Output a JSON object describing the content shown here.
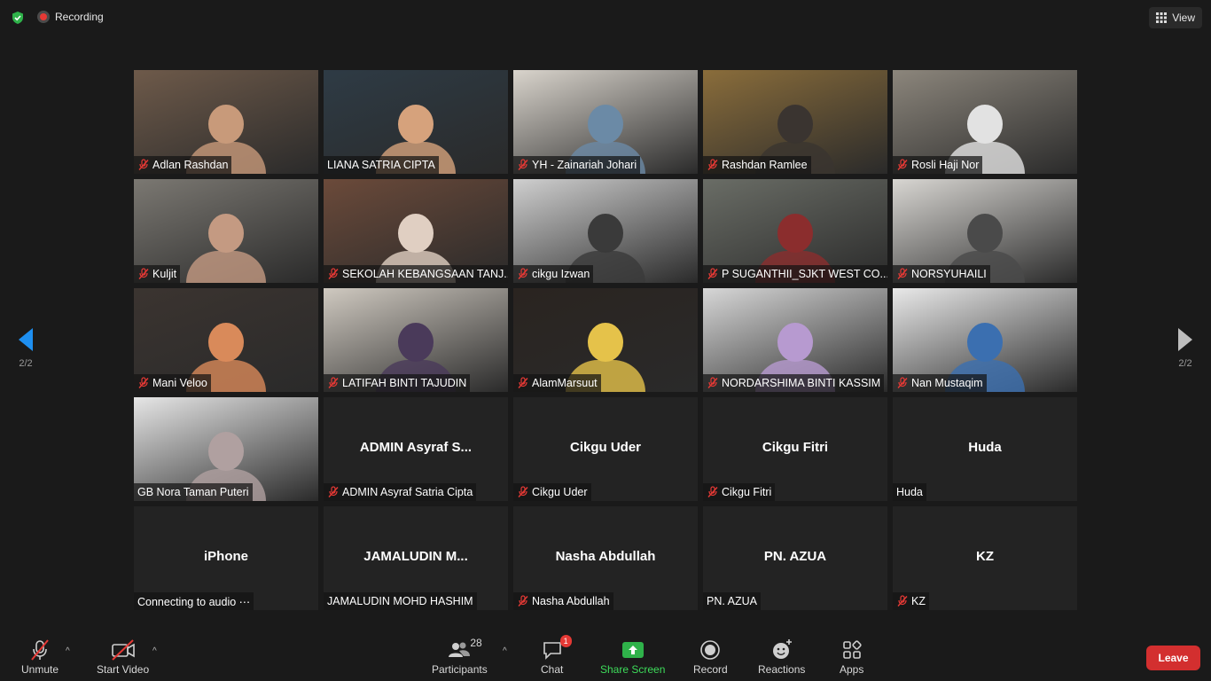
{
  "top": {
    "recording_label": "Recording",
    "view_label": "View"
  },
  "pager": {
    "left": "2/2",
    "right": "2/2"
  },
  "tiles": [
    {
      "name": "Adlan Rashdan",
      "muted": true,
      "video": true,
      "bg": "#6e5a4a",
      "fg": "#c89a7a",
      "active": false
    },
    {
      "name": "LIANA SATRIA CIPTA",
      "muted": false,
      "video": true,
      "bg": "#2e3b45",
      "fg": "#d6a27c",
      "active": true
    },
    {
      "name": "YH - Zainariah Johari",
      "muted": true,
      "video": true,
      "bg": "#d9d4cc",
      "fg": "#6b8aa6",
      "active": false
    },
    {
      "name": "Rashdan Ramlee",
      "muted": true,
      "video": true,
      "bg": "#8a6d3b",
      "fg": "#3a3430",
      "active": false
    },
    {
      "name": "Rosli Haji Nor",
      "muted": true,
      "video": true,
      "bg": "#8c867c",
      "fg": "#e2e2e2",
      "active": false
    },
    {
      "name": "Kuljit",
      "muted": true,
      "video": true,
      "bg": "#7b7872",
      "fg": "#c49a82",
      "active": false
    },
    {
      "name": "SEKOLAH KEBANGSAAN TANJ...",
      "muted": true,
      "video": true,
      "bg": "#6b4a3a",
      "fg": "#e0cfc2",
      "active": false
    },
    {
      "name": "cikgu Izwan",
      "muted": true,
      "video": true,
      "bg": "#cfcfcf",
      "fg": "#3a3a3a",
      "active": false
    },
    {
      "name": "P SUGANTHII_SJKT WEST CO...",
      "muted": true,
      "video": true,
      "bg": "#6a6d66",
      "fg": "#8b2d2d",
      "active": false
    },
    {
      "name": "NORSYUHAILI",
      "muted": true,
      "video": true,
      "bg": "#d8d6d2",
      "fg": "#4a4a4a",
      "active": false
    },
    {
      "name": "Mani Veloo",
      "muted": true,
      "video": true,
      "bg": "#3b3430",
      "fg": "#d98a5a",
      "active": false
    },
    {
      "name": "LATIFAH BINTI TAJUDIN",
      "muted": true,
      "video": true,
      "bg": "#cfc9c0",
      "fg": "#4a3a5a",
      "active": false
    },
    {
      "name": "AlamMarsuut",
      "muted": true,
      "video": true,
      "bg": "#2a2420",
      "fg": "#e5c24a",
      "active": false
    },
    {
      "name": "NORDARSHIMA BINTI KASSIM",
      "muted": true,
      "video": true,
      "bg": "#d7d7d7",
      "fg": "#b79ad0",
      "active": false
    },
    {
      "name": "Nan Mustaqim",
      "muted": true,
      "video": true,
      "bg": "#e9e9e9",
      "fg": "#3b6fb0",
      "active": false
    },
    {
      "name": "GB Nora Taman Puteri",
      "muted": false,
      "video": true,
      "bg": "#e6e6e6",
      "fg": "#b0a0a0",
      "active": false
    },
    {
      "name": "ADMIN Asyraf Satria Cipta",
      "big": "ADMIN Asyraf S...",
      "muted": true,
      "video": false,
      "active": false
    },
    {
      "name": "Cikgu Uder",
      "big": "Cikgu Uder",
      "muted": true,
      "video": false,
      "active": false
    },
    {
      "name": "Cikgu Fitri",
      "big": "Cikgu Fitri",
      "muted": true,
      "video": false,
      "active": false
    },
    {
      "name": "Huda",
      "big": "Huda",
      "muted": false,
      "video": false,
      "active": false
    },
    {
      "name": "Connecting to audio ⋯",
      "big": "iPhone",
      "muted": false,
      "video": false,
      "active": false
    },
    {
      "name": "JAMALUDIN MOHD HASHIM",
      "big": "JAMALUDIN M...",
      "muted": false,
      "video": false,
      "active": false
    },
    {
      "name": "Nasha Abdullah",
      "big": "Nasha Abdullah",
      "muted": true,
      "video": false,
      "active": false
    },
    {
      "name": "PN. AZUA",
      "big": "PN. AZUA",
      "muted": false,
      "video": false,
      "active": false
    },
    {
      "name": "KZ",
      "big": "KZ",
      "muted": true,
      "video": false,
      "active": false
    }
  ],
  "toolbar": {
    "unmute": "Unmute",
    "start_video": "Start Video",
    "participants": "Participants",
    "participants_count": "28",
    "chat": "Chat",
    "chat_badge": "1",
    "share_screen": "Share Screen",
    "record": "Record",
    "reactions": "Reactions",
    "apps": "Apps",
    "leave": "Leave"
  },
  "colors": {
    "accent_green": "#3ddc5a",
    "active_border": "#c5e36b",
    "leave_red": "#d32f2f"
  }
}
